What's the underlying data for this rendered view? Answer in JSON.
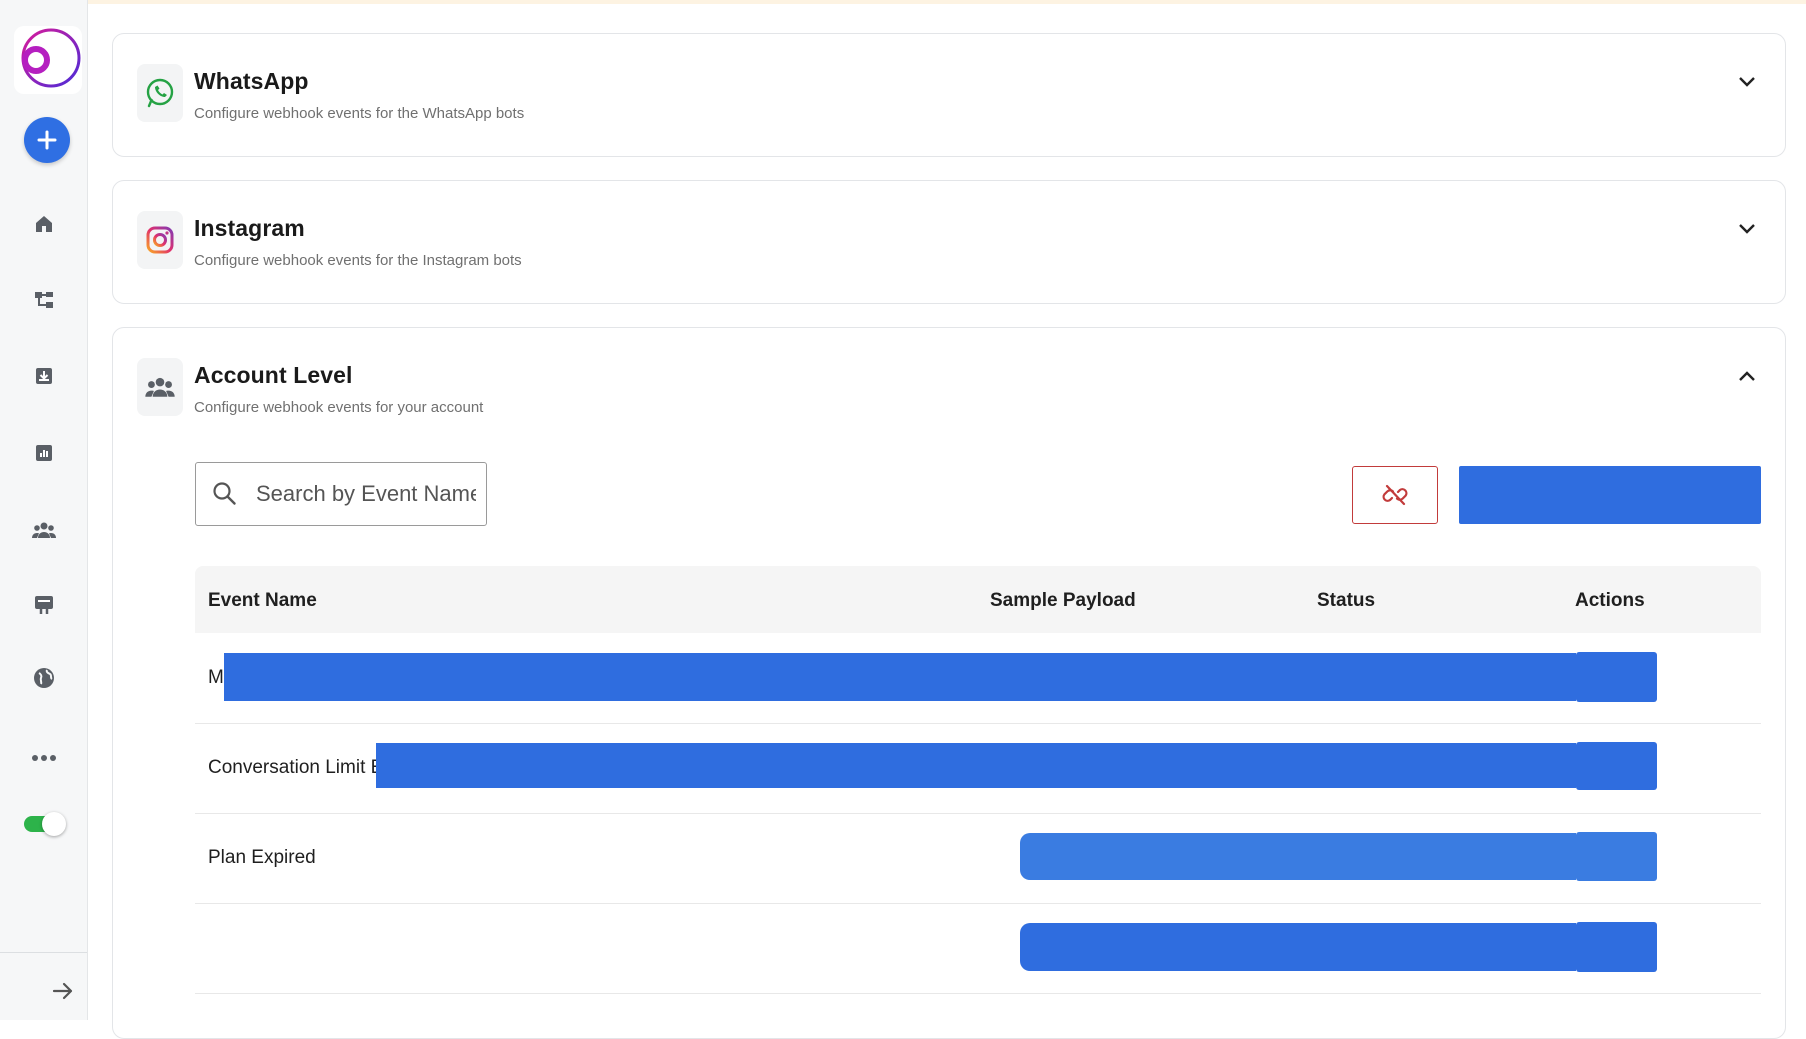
{
  "sidebar": {
    "logo_icon": "brand-logo-icon",
    "add_button_icon": "plus-icon",
    "nav_items": [
      {
        "name": "home",
        "icon": "home-icon"
      },
      {
        "name": "flows",
        "icon": "flow-tree-icon"
      },
      {
        "name": "inbox",
        "icon": "inbox-download-icon"
      },
      {
        "name": "analytics",
        "icon": "bar-chart-icon"
      },
      {
        "name": "contacts",
        "icon": "users-group-icon"
      },
      {
        "name": "templates",
        "icon": "signboard-icon"
      },
      {
        "name": "integrations",
        "icon": "globe-icon"
      },
      {
        "name": "more",
        "icon": "more-horizontal-icon"
      }
    ],
    "toggle_on": true,
    "collapse_icon": "arrow-right-icon"
  },
  "sections": {
    "whatsapp": {
      "title": "WhatsApp",
      "subtitle": "Configure webhook events for the WhatsApp bots",
      "expanded": false
    },
    "instagram": {
      "title": "Instagram",
      "subtitle": "Configure webhook events for the Instagram bots",
      "expanded": false
    },
    "account": {
      "title": "Account Level",
      "subtitle": "Configure webhook events for your account",
      "expanded": true
    }
  },
  "search": {
    "placeholder": "Search by Event Name",
    "value": ""
  },
  "toolbar": {
    "unlink_icon": "unlink-icon",
    "primary_label": ""
  },
  "table": {
    "columns": [
      "Event Name",
      "Sample Payload",
      "Status",
      "Actions"
    ],
    "rows": [
      {
        "event_name": "M"
      },
      {
        "event_name": "Conversation Limit Exh"
      },
      {
        "event_name": "Plan Expired"
      },
      {
        "event_name": ""
      }
    ]
  },
  "colors": {
    "accent": "#2f6ddf",
    "danger": "#c23b3b",
    "toggle": "#2db34a",
    "whatsapp": "#25a244",
    "instagram": "#e1306c"
  }
}
